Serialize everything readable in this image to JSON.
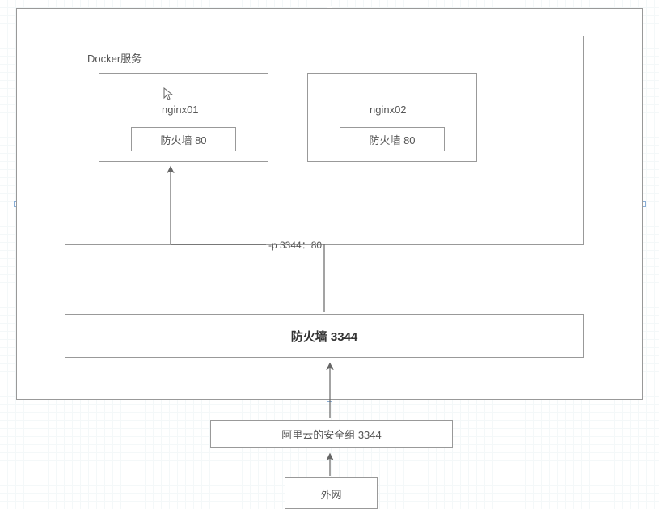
{
  "dockerService": {
    "label": "Docker服务"
  },
  "nginx01": {
    "title": "nginx01",
    "firewall": "防火墙  80"
  },
  "nginx02": {
    "title": "nginx02",
    "firewall": "防火墙  80"
  },
  "portMapping": "-p 3344：80",
  "hostFirewall": "防火墙   3344",
  "securityGroup": "阿里云的安全组   3344",
  "externalNetwork": "外网"
}
